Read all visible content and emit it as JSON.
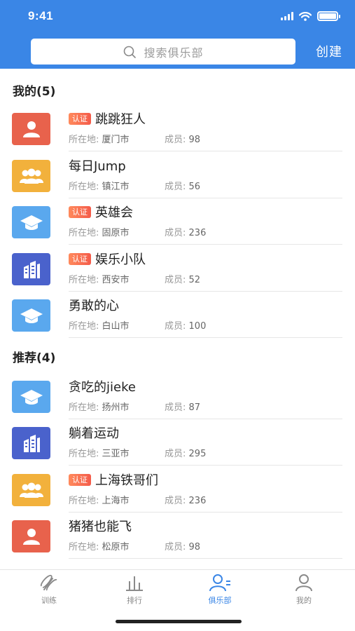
{
  "status": {
    "time": "9:41"
  },
  "search": {
    "placeholder": "搜索俱乐部"
  },
  "header": {
    "create_label": "创建"
  },
  "sections": {
    "mine": {
      "title": "我的(5)"
    },
    "recommended": {
      "title": "推荐(4)"
    }
  },
  "labels": {
    "location": "所在地:",
    "members": "成员:"
  },
  "clubs": [
    {
      "name": "跳跳狂人",
      "badge": "认证",
      "city": "厦门市",
      "members": "98",
      "icon": "person-icon",
      "color": "#e8624c"
    },
    {
      "name": "每日Jump",
      "badge": "",
      "city": "镇江市",
      "members": "56",
      "icon": "group-icon",
      "color": "#f2b13c"
    },
    {
      "name": "英雄会",
      "badge": "认证",
      "city": "固原市",
      "members": "236",
      "icon": "graduation-cap-icon",
      "color": "#5aa8ee"
    },
    {
      "name": "娱乐小队",
      "badge": "认证",
      "city": "西安市",
      "members": "52",
      "icon": "building-icon",
      "color": "#4a62cc"
    },
    {
      "name": "勇敢的心",
      "badge": "",
      "city": "白山市",
      "members": "100",
      "icon": "graduation-cap-icon",
      "color": "#5aa8ee"
    },
    {
      "name": "贪吃的jieke",
      "badge": "",
      "city": "扬州市",
      "members": "87",
      "icon": "graduation-cap-icon",
      "color": "#5aa8ee"
    },
    {
      "name": "躺着运动",
      "badge": "",
      "city": "三亚市",
      "members": "295",
      "icon": "building-icon",
      "color": "#4a62cc"
    },
    {
      "name": "上海铁哥们",
      "badge": "认证",
      "city": "上海市",
      "members": "236",
      "icon": "group-icon",
      "color": "#f2b13c"
    },
    {
      "name": "猪猪也能飞",
      "badge": "",
      "city": "松原市",
      "members": "98",
      "icon": "person-icon",
      "color": "#e8624c"
    }
  ],
  "tabs": [
    {
      "label": "训练",
      "icon": "training-icon",
      "active": false
    },
    {
      "label": "排行",
      "icon": "ranking-icon",
      "active": false
    },
    {
      "label": "俱乐部",
      "icon": "club-icon",
      "active": true
    },
    {
      "label": "我的",
      "icon": "profile-icon",
      "active": false
    }
  ],
  "colors": {
    "accent": "#3a86e6",
    "badge": "#f45b4a"
  }
}
